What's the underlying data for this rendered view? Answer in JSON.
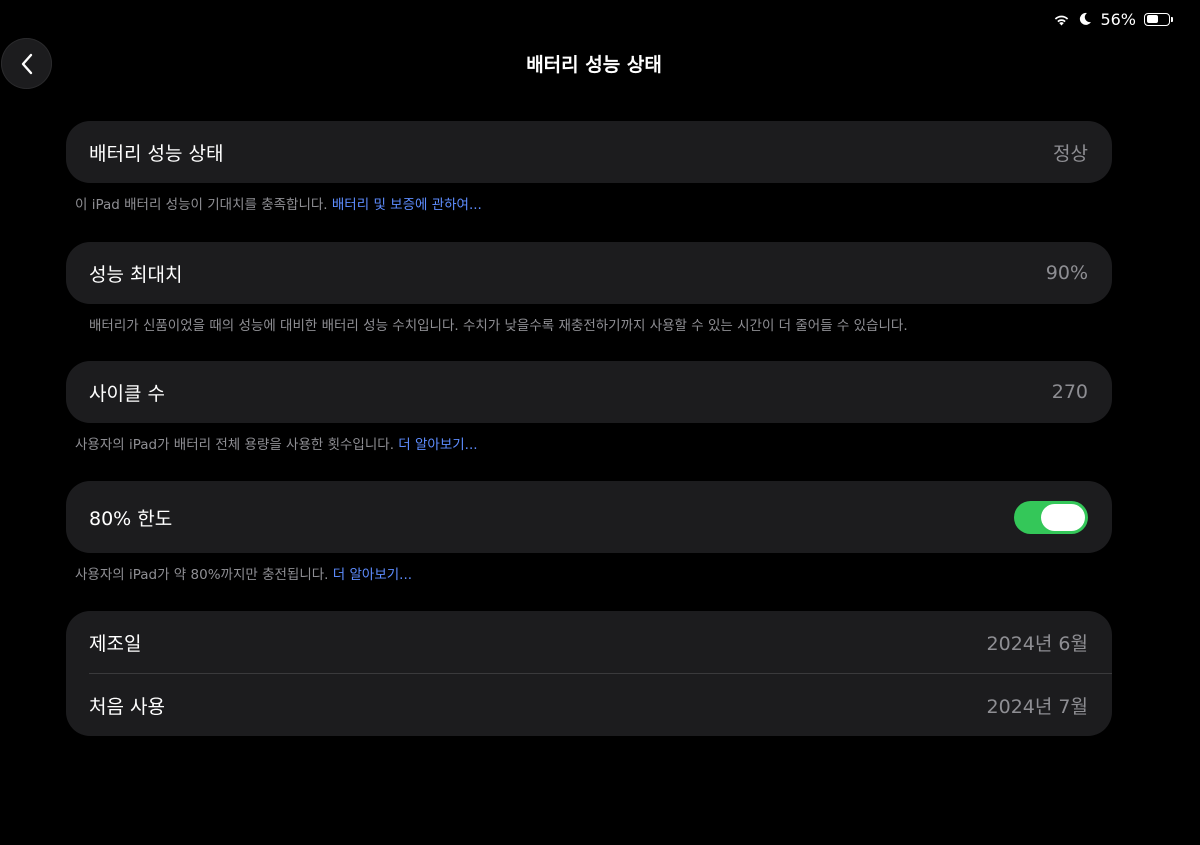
{
  "status_bar": {
    "wifi_icon": "wifi-icon",
    "focus_icon": "moon-icon",
    "battery_percent": "56%",
    "battery_level": 0.56
  },
  "header": {
    "title": "배터리 성능 상태",
    "back_icon": "chevron-left-icon"
  },
  "sections": {
    "health": {
      "label": "배터리 성능 상태",
      "value": "정상",
      "footnote_text": "이 iPad 배터리 성능이 기대치를 충족합니다. ",
      "footnote_link": "배터리 및 보증에 관하여..."
    },
    "max_capacity": {
      "label": "성능 최대치",
      "value": "90%",
      "footnote_text": "배터리가 신품이었을 때의 성능에 대비한 배터리 성능 수치입니다. 수치가 낮을수록 재충전하기까지 사용할 수 있는 시간이 더 줄어들 수 있습니다."
    },
    "cycle_count": {
      "label": "사이클 수",
      "value": "270",
      "footnote_text": "사용자의 iPad가 배터리 전체 용량을 사용한 횟수입니다. ",
      "footnote_link": "더 알아보기..."
    },
    "limit_80": {
      "label": "80% 한도",
      "toggle_on": true,
      "toggle_color": "#34c759",
      "footnote_text": "사용자의 iPad가 약 80%까지만 충전됩니다. ",
      "footnote_link": "더 알아보기..."
    },
    "dates": {
      "manufacture_label": "제조일",
      "manufacture_value": "2024년 6월",
      "first_use_label": "처음 사용",
      "first_use_value": "2024년 7월"
    }
  }
}
